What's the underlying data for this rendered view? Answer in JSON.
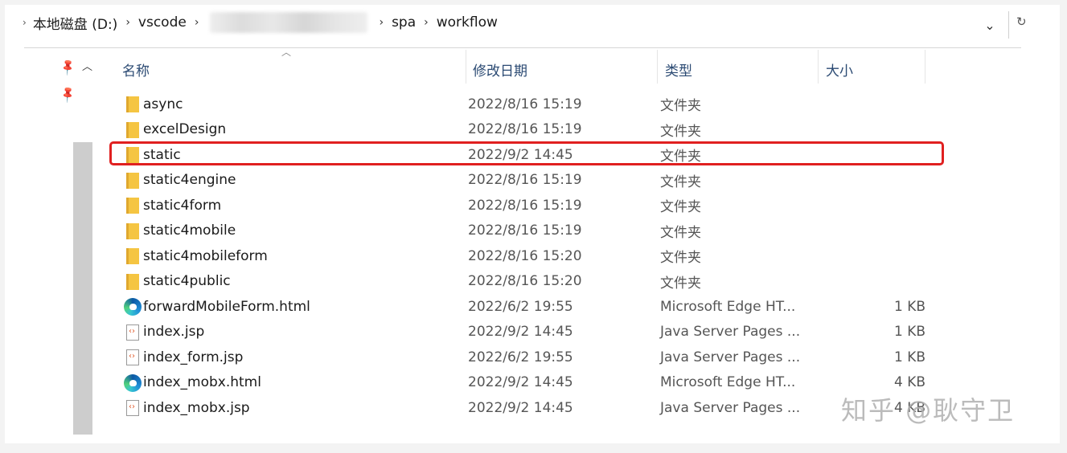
{
  "breadcrumb": {
    "items": [
      "本地磁盘 (D:)",
      "vscode",
      "spa",
      "workflow"
    ]
  },
  "columns": {
    "name": "名称",
    "date": "修改日期",
    "type": "类型",
    "size": "大小"
  },
  "files": [
    {
      "name": "async",
      "date": "2022/8/16 15:19",
      "type": "文件夹",
      "size": "",
      "icon": "folder-icon"
    },
    {
      "name": "excelDesign",
      "date": "2022/8/16 15:19",
      "type": "文件夹",
      "size": "",
      "icon": "folder-icon"
    },
    {
      "name": "static",
      "date": "2022/9/2 14:45",
      "type": "文件夹",
      "size": "",
      "icon": "folder-icon",
      "highlighted": true
    },
    {
      "name": "static4engine",
      "date": "2022/8/16 15:19",
      "type": "文件夹",
      "size": "",
      "icon": "folder-icon"
    },
    {
      "name": "static4form",
      "date": "2022/8/16 15:19",
      "type": "文件夹",
      "size": "",
      "icon": "folder-icon"
    },
    {
      "name": "static4mobile",
      "date": "2022/8/16 15:19",
      "type": "文件夹",
      "size": "",
      "icon": "folder-icon"
    },
    {
      "name": "static4mobileform",
      "date": "2022/8/16 15:20",
      "type": "文件夹",
      "size": "",
      "icon": "folder-icon"
    },
    {
      "name": "static4public",
      "date": "2022/8/16 15:20",
      "type": "文件夹",
      "size": "",
      "icon": "folder-icon"
    },
    {
      "name": "forwardMobileForm.html",
      "date": "2022/6/2 19:55",
      "type": "Microsoft Edge HT...",
      "size": "1 KB",
      "icon": "edge-icon"
    },
    {
      "name": "index.jsp",
      "date": "2022/9/2 14:45",
      "type": "Java Server Pages ...",
      "size": "1 KB",
      "icon": "jsp-file-icon"
    },
    {
      "name": "index_form.jsp",
      "date": "2022/6/2 19:55",
      "type": "Java Server Pages ...",
      "size": "1 KB",
      "icon": "jsp-file-icon"
    },
    {
      "name": "index_mobx.html",
      "date": "2022/9/2 14:45",
      "type": "Microsoft Edge HT...",
      "size": "4 KB",
      "icon": "edge-icon"
    },
    {
      "name": "index_mobx.jsp",
      "date": "2022/9/2 14:45",
      "type": "Java Server Pages ...",
      "size": "4 KB",
      "icon": "jsp-file-icon"
    }
  ],
  "watermark": "知乎 @耿守卫",
  "colors": {
    "highlight": "#e02020",
    "header_text": "#2b4a73"
  }
}
